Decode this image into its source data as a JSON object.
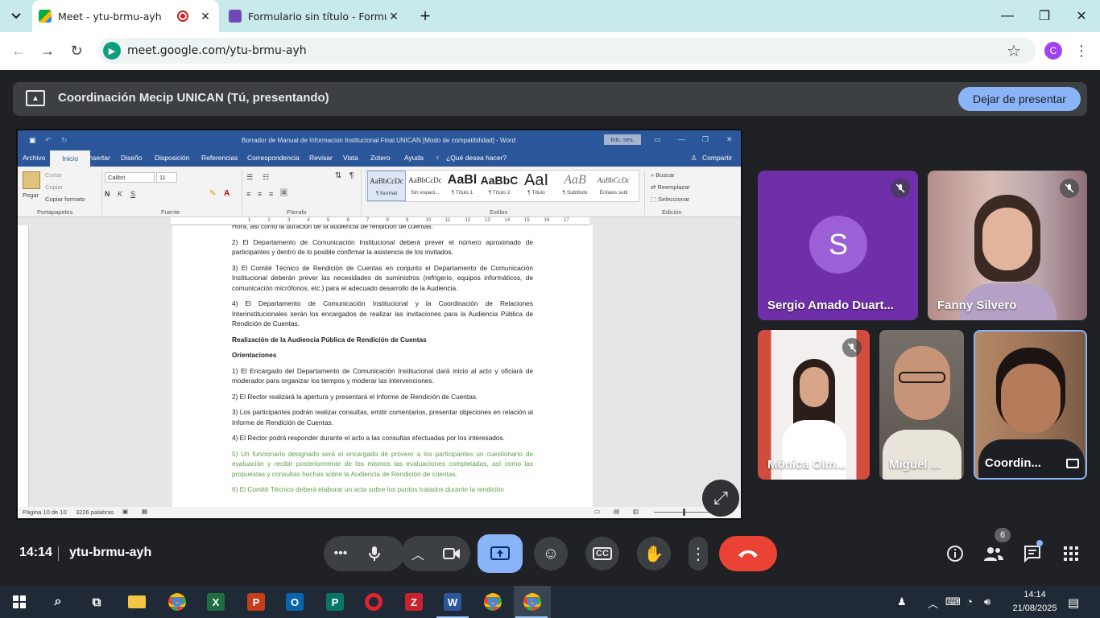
{
  "browser": {
    "tabs": [
      {
        "title": "Meet - ytu-brmu-ayh",
        "active": true
      },
      {
        "title": "Formulario sin título - Formular",
        "active": false
      }
    ],
    "url": "meet.google.com/ytu-brmu-ayh",
    "profile_initial": "C"
  },
  "presenting": {
    "label": "Coordinación Mecip UNICAN (Tú, presentando)",
    "stop_button": "Dejar de presentar"
  },
  "word": {
    "title": "Borrador de Manual de Informacion Institucional Final.UNICAN [Modo de compatibilidad]  -  Word",
    "signin": "Inic. ses.",
    "ribbon_tabs": [
      "Archivo",
      "Inicio",
      "Insertar",
      "Diseño",
      "Disposición",
      "Referencias",
      "Correspondencia",
      "Revisar",
      "Vista",
      "Zotero",
      "Ayuda"
    ],
    "tell_me": "¿Qué desea hacer?",
    "share": "Compartir",
    "groups": {
      "clipboard": "Portapapeles",
      "font": "Fuente",
      "paragraph": "Párrafo",
      "styles": "Estilos",
      "editing": "Edición"
    },
    "clipboard_items": {
      "paste": "Pegar",
      "cut": "Cortar",
      "copy": "Copiar",
      "format": "Copiar formato"
    },
    "font_name": "Calibri",
    "font_size": "11",
    "styles": [
      {
        "preview": "AaBbCcDc",
        "name": "¶ Normal"
      },
      {
        "preview": "AaBbCcDc",
        "name": "Sin espaci..."
      },
      {
        "preview": "AaBl",
        "name": "¶ Título 1"
      },
      {
        "preview": "AaBbC",
        "name": "¶ Título 2"
      },
      {
        "preview": "AaI",
        "name": "¶ Título"
      },
      {
        "preview": "AaB",
        "name": "¶ Subtítulo"
      },
      {
        "preview": "AaBbCcDc",
        "name": "Énfasis sutil"
      }
    ],
    "editing": {
      "find": "Buscar",
      "replace": "Reemplazar",
      "select": "Seleccionar"
    },
    "paragraphs": [
      {
        "text": "Hora, así como la duración de la audiencia de rendición de cuentas.",
        "style": ""
      },
      {
        "text": "2) El Departamento de Comunicación Institucional deberá prever el número aproximado de participantes y dentro de lo posible confirmar la asistencia de los invitados.",
        "style": ""
      },
      {
        "text": "3) El Comité Técnico de Rendición de Cuentas en conjunto el Departamento de Comunicación Institucional deberán prever las necesidades de suministros (refrigerio, equipos informáticos, de comunicación micrófonos, etc.) para el adecuado desarrollo de la Audiencia.",
        "style": ""
      },
      {
        "text": "4) El Departamento de Comunicación Institucional y la Coordinación de Relaciones Interinstitucionales serán los encargados de realizar las invitaciones para la Audiencia Pública de Rendición de Cuentas.",
        "style": ""
      },
      {
        "text": "Realización de la Audiencia Pública de Rendición de Cuentas",
        "style": "b"
      },
      {
        "text": "Orientaciones",
        "style": "b"
      },
      {
        "text": "1) El Encargado del Departamento de Comunicación Institucional dará inicio al acto y oficiará de moderador para organizar los tiempos y moderar las intervenciones.",
        "style": ""
      },
      {
        "text": "2) El Rector realizará la apertura y presentará el Informe de Rendición de Cuentas.",
        "style": ""
      },
      {
        "text": "3) Los participantes podrán realizar consultas, emitir comentarios, presentar objeciones en relación al Informe de Rendición de Cuentas.",
        "style": ""
      },
      {
        "text": "4) El Rector podrá responder durante el acto a las consultas efectuadas por los interesados.",
        "style": ""
      },
      {
        "text": "5) Un funcionario designado será el encargado de proveer a los participantes un cuestionario de evaluación y recibir posteriormente de los mismos las evaluaciones completadas, así como las propuestas y consultas hechas sobre la Audiencia de Rendición de cuentas.",
        "style": "g"
      },
      {
        "text": "6) El Comité Técnico deberá elaborar un acta sobre los puntos tratados durante la rendición",
        "style": "g"
      }
    ],
    "status_page": "Página 10 de 10",
    "status_words": "3226 palabras"
  },
  "participants": [
    {
      "name": "Sergio Amado Duart...",
      "initial": "S",
      "muted": true,
      "bg": "#6f2fa8",
      "avatar": "#9c5fd6"
    },
    {
      "name": "Fanny Silvero",
      "muted": true,
      "bg": "#b58a86"
    },
    {
      "name": "Mónica Olm...",
      "muted": true,
      "bg": "#c94b3c"
    },
    {
      "name": "Miguel ...",
      "muted": false,
      "bg": "#6a6258"
    },
    {
      "name": "Coordin...",
      "muted": false,
      "bg": "#8a6b52"
    }
  ],
  "meeting": {
    "time": "14:14",
    "code": "ytu-brmu-ayh",
    "participant_count": "6"
  },
  "taskbar": {
    "time": "14:14",
    "date": "21/08/2025"
  },
  "colors": {
    "meet_bg": "#202124",
    "stop_button": "#8ab4f8",
    "end_call": "#ea4335",
    "word_blue": "#2b579a",
    "present_active": "#8ab4f8"
  }
}
